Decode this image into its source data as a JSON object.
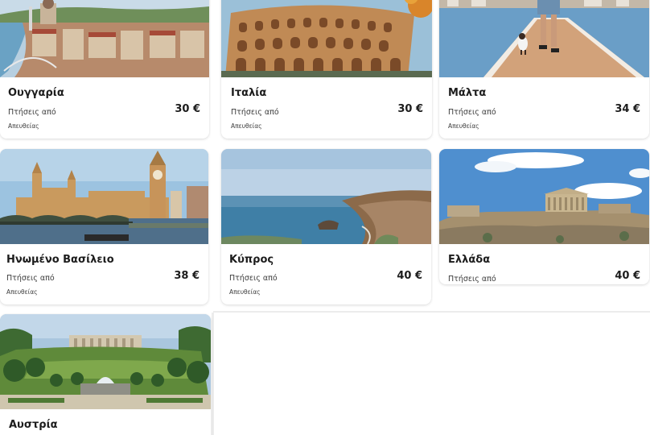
{
  "destinations": [
    {
      "title": "Ουγγαρία",
      "from_label": "Πτήσεις από",
      "price": "30 €",
      "direct_label": "Απευθείας"
    },
    {
      "title": "Ιταλία",
      "from_label": "Πτήσεις από",
      "price": "30 €",
      "direct_label": "Απευθείας"
    },
    {
      "title": "Μάλτα",
      "from_label": "Πτήσεις από",
      "price": "34 €",
      "direct_label": "Απευθείας"
    },
    {
      "title": "Ηνωμένο Βασίλειο",
      "from_label": "Πτήσεις από",
      "price": "38 €",
      "direct_label": "Απευθείας"
    },
    {
      "title": "Κύπρος",
      "from_label": "Πτήσεις από",
      "price": "40 €",
      "direct_label": "Απευθείας"
    },
    {
      "title": "Ελλάδα",
      "from_label": "Πτήσεις από",
      "price": "40 €"
    },
    {
      "title": "Αυστρία"
    }
  ]
}
